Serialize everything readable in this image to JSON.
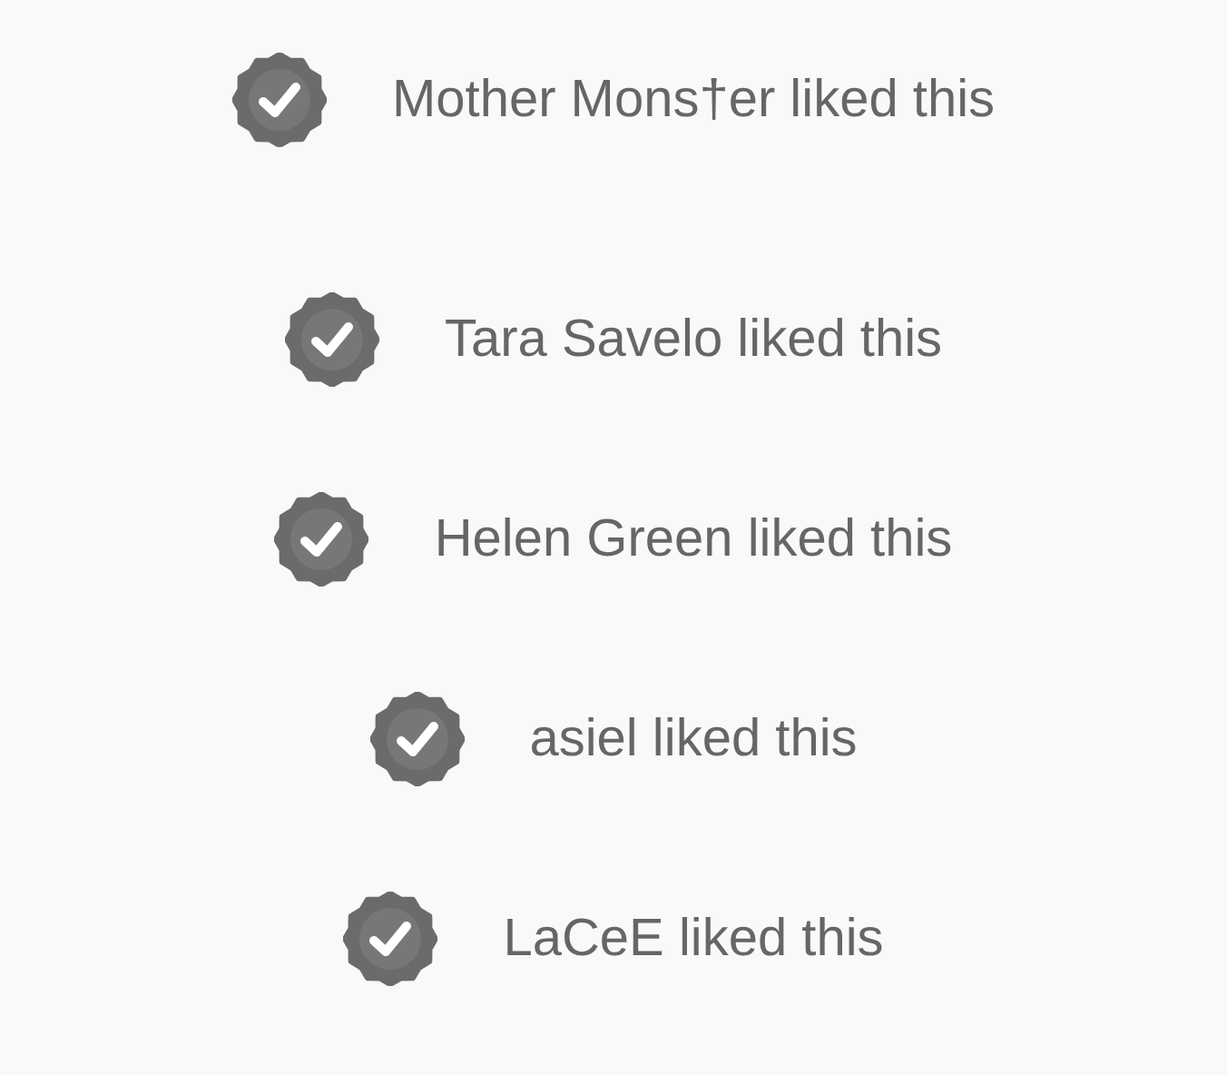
{
  "likes": [
    {
      "text": "Mother Mons†er liked this"
    },
    {
      "text": "Tara Savelo liked this"
    },
    {
      "text": "Helen Green liked this"
    },
    {
      "text": "asiel liked this"
    },
    {
      "text": "LaCeE liked this"
    }
  ]
}
